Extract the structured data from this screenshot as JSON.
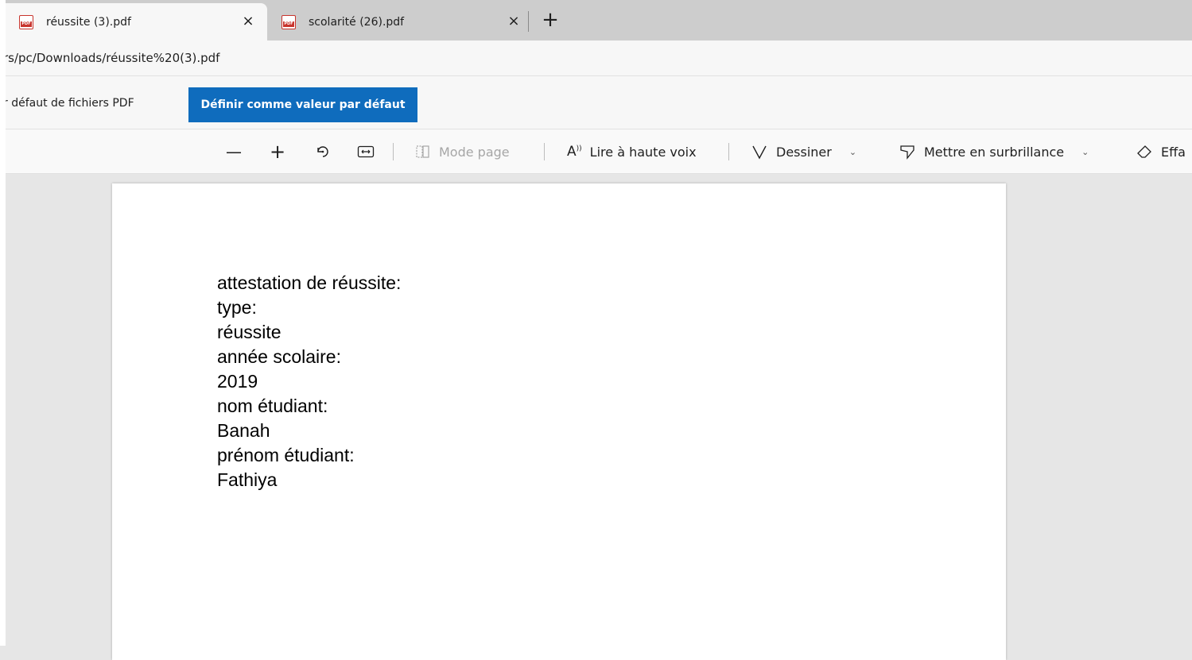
{
  "tabs": [
    {
      "title": "réussite (3).pdf",
      "close": "×",
      "icon": "pdf-file-icon",
      "active": true
    },
    {
      "title": "scolarité (26).pdf",
      "close": "×",
      "icon": "pdf-file-icon",
      "active": false
    }
  ],
  "new_tab_symbol": "+",
  "address": {
    "url": "rs/pc/Downloads/réussite%20(3).pdf"
  },
  "infobar": {
    "text": "r défaut de fichiers PDF",
    "button_label": "Définir comme valeur par défaut",
    "button_color": "#0f6cbd"
  },
  "pdf_toolbar": {
    "zoom_out": "—",
    "zoom_in": "+",
    "page_mode": "Mode page",
    "read_aloud": "Lire à haute voix",
    "draw": "Dessiner",
    "highlight": "Mettre en surbrillance",
    "erase": "Effa",
    "chevron": "⌄"
  },
  "document": {
    "lines": [
      "attestation de réussite:",
      "type:",
      "réussite",
      "année scolaire:",
      "2019",
      "nom étudiant:",
      "Banah",
      "prénom étudiant:",
      "Fathiya"
    ]
  }
}
